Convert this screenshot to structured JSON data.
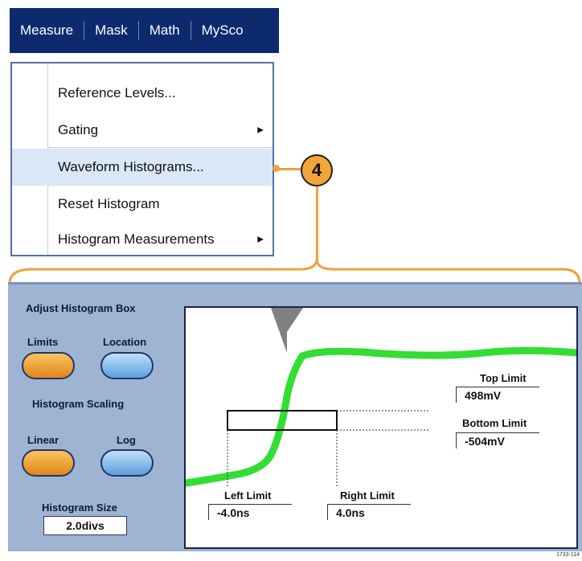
{
  "menu": {
    "items": [
      "Measure",
      "Mask",
      "Math",
      "MySco"
    ]
  },
  "dropdown": {
    "items": [
      {
        "label": "Reference Levels...",
        "submenu": false
      },
      {
        "label": "Gating",
        "submenu": true
      },
      {
        "label": "Waveform Histograms...",
        "submenu": false,
        "highlighted": true
      },
      {
        "label": "Reset Histogram",
        "submenu": false
      },
      {
        "label": "Histogram Measurements",
        "submenu": true
      }
    ]
  },
  "callout": {
    "number": "4"
  },
  "panel": {
    "adjust_title": "Adjust Histogram Box",
    "limits_label": "Limits",
    "location_label": "Location",
    "scaling_title": "Histogram Scaling",
    "linear_label": "Linear",
    "log_label": "Log",
    "size_title": "Histogram Size",
    "size_value": "2.0divs"
  },
  "display": {
    "top_limit_label": "Top Limit",
    "top_limit_value": "498mV",
    "bottom_limit_label": "Bottom Limit",
    "bottom_limit_value": "-504mV",
    "left_limit_label": "Left Limit",
    "left_limit_value": "-4.0ns",
    "right_limit_label": "Right Limit",
    "right_limit_value": "4.0ns"
  },
  "figure_id": "1733-114",
  "colors": {
    "menubar": "#0d2a6e",
    "highlight": "#d9e7f6",
    "callout": "#f3a53a",
    "panel": "#9fb3d3",
    "selected_button": "#f0a030",
    "unselected_button": "#7fb6e8",
    "waveform": "#33dd33"
  }
}
